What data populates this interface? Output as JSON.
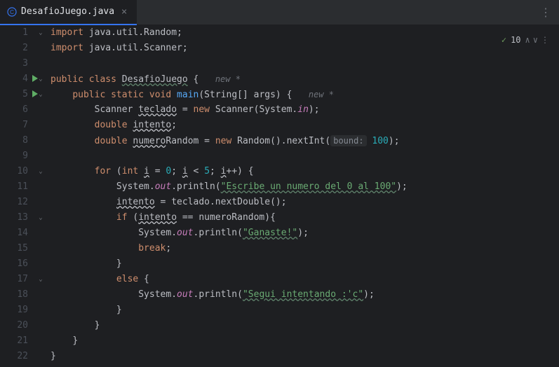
{
  "tab": {
    "filename": "DesafioJuego.java",
    "close_glyph": "×",
    "more_glyph": "⋮"
  },
  "status": {
    "check": "✓",
    "count": "10",
    "up": "∧",
    "down": "∨",
    "menu": "⋮"
  },
  "gutter": [
    "1",
    "2",
    "3",
    "4",
    "5",
    "6",
    "7",
    "8",
    "9",
    "10",
    "11",
    "12",
    "13",
    "14",
    "15",
    "16",
    "17",
    "18",
    "19",
    "20",
    "21",
    "22"
  ],
  "folds": {
    "l1": "⌄",
    "l4": "⌄",
    "l5": "⌄",
    "l10": "⌄",
    "l13": "⌄",
    "l17": "⌄"
  },
  "code": {
    "import": "import",
    "java_util_random": " java.util.Random;",
    "java_util_scanner": " java.util.Scanner;",
    "public": "public",
    "class": "class",
    "DesafioJuego": "DesafioJuego",
    "lbrace": " {",
    "new_hint": "new *",
    "static": "static",
    "void": "void",
    "main": "main",
    "main_params": "(String[] args) {",
    "Scanner": "Scanner ",
    "teclado": "teclado",
    "eq_new": " = ",
    "new": "new",
    "scanner_ctor": " Scanner(System.",
    "in": "in",
    "close_paren_semi": ");",
    "double": "double",
    "intento": "intento",
    "semi": ";",
    "numeroRandom_pre": "numero",
    "numeroRandom_suf": "Random = ",
    "random_ctor": " Random().nextInt(",
    "bound_hint": "bound:",
    "hundred": " 100",
    "for": "for",
    "for_open": " (",
    "int": "int",
    "i": "i",
    "assign_zero": " = ",
    "zero": "0",
    "sep": "; ",
    "lt": " < ",
    "five": "5",
    "inc": "++) {",
    "System": "System.",
    "out": "out",
    "println": ".println(",
    "str1": "\"Escribe un numero del 0 al 100\"",
    "close_call": ");",
    "eq_teclado": " = teclado.nextDouble();",
    "if": "if",
    "if_cond_open": " (",
    "eqeq": " == numeroRandom){",
    "str2": "\"Ganaste!\"",
    "break": "break",
    "rbrace": "}",
    "else": "else",
    "else_open": " {",
    "str3": "\"Segui intentando :'c\"",
    "numero_u": "numero"
  }
}
